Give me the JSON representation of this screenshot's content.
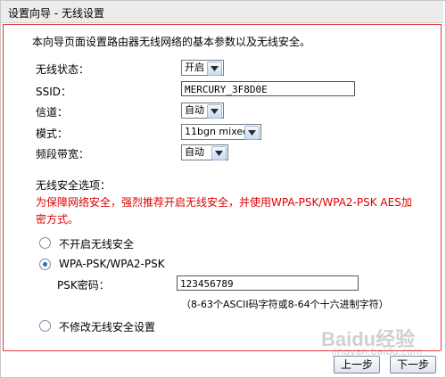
{
  "title": "设置向导 - 无线设置",
  "intro": "本向导页面设置路由器无线网络的基本参数以及无线安全。",
  "fields": {
    "wireless_status": {
      "label": "无线状态：",
      "value": "开启"
    },
    "ssid": {
      "label": "SSID：",
      "value": "MERCURY_3F8D0E"
    },
    "channel": {
      "label": "信道：",
      "value": "自动"
    },
    "mode": {
      "label": "模式：",
      "value": "11bgn mixed"
    },
    "bandwidth": {
      "label": "频段带宽：",
      "value": "自动"
    }
  },
  "security": {
    "title": "无线安全选项：",
    "warning": "为保障网络安全，强烈推荐开启无线安全，并使用WPA-PSK/WPA2-PSK AES加密方式。",
    "options": [
      {
        "label": "不开启无线安全",
        "checked": false
      },
      {
        "label": "WPA-PSK/WPA2-PSK",
        "checked": true
      },
      {
        "label": "不修改无线安全设置",
        "checked": false
      }
    ],
    "psk_label": "PSK密码：",
    "psk_value": "123456789",
    "psk_hint": "（8-63个ASCII码字符或8-64个十六进制字符）"
  },
  "buttons": {
    "prev": "上一步",
    "next": "下一步"
  },
  "watermark": {
    "brand": "Baidu经验",
    "url": "jingyan.baidu.com"
  }
}
